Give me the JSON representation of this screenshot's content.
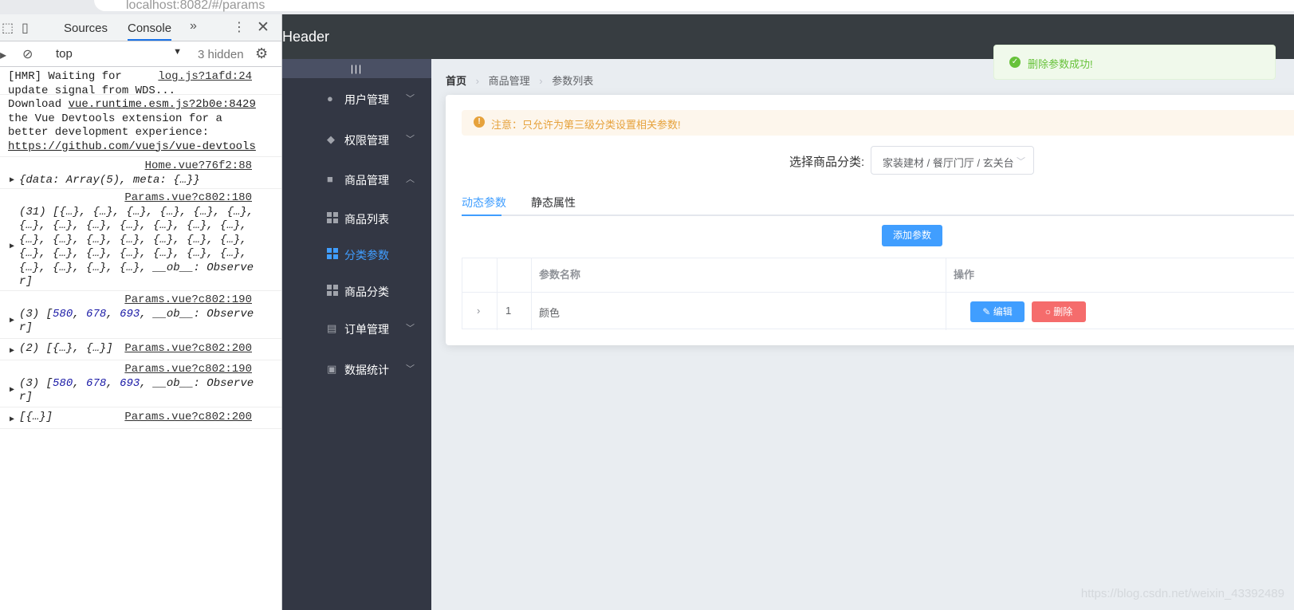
{
  "browser": {
    "url_fragment": "localhost:8082/#/params"
  },
  "devtools": {
    "tabs": [
      "Sources",
      "Console"
    ],
    "active_tab": "Console",
    "context": "top",
    "hidden_count": "3 hidden",
    "logs": [
      {
        "text": "[HMR] Waiting for\nupdate signal from WDS...",
        "source": "log.js?1afd:24"
      },
      {
        "text": "Download ",
        "link": "vue.runtime.esm.js?2b0e:8429",
        "rest": "\nthe Vue Devtools extension for a\nbetter development experience:",
        "url": "https://github.com/vuejs/vue-devtools"
      },
      {
        "source": "Home.vue?76f2:88",
        "object": "{data: Array(5), meta: {…}}"
      },
      {
        "source": "Params.vue?c802:180",
        "object": "(31) [{…}, {…}, {…}, {…}, {…}, {…},\n{…}, {…}, {…}, {…}, {…}, {…}, {…},\n{…}, {…}, {…}, {…}, {…}, {…}, {…},\n{…}, {…}, {…}, {…}, {…}, {…}, {…},\n{…}, {…}, {…}, {…}, __ob__: Observe\nr]"
      },
      {
        "source": "Params.vue?c802:190",
        "object_prefix": "(3) [",
        "values": [
          "580",
          "678",
          "693"
        ],
        "object_suffix": ", __ob__: Observe\nr]"
      },
      {
        "source": "Params.vue?c802:200",
        "object": "(2) [{…}, {…}]"
      },
      {
        "source": "Params.vue?c802:190",
        "object_prefix": "(3) [",
        "values": [
          "580",
          "678",
          "693"
        ],
        "object_suffix": ", __ob__: Observe\nr]"
      },
      {
        "source": "Params.vue?c802:200",
        "object": "[{…}]"
      }
    ]
  },
  "app": {
    "header_title": "Header",
    "toggle_label": "|||",
    "menu": [
      {
        "label": "用户管理",
        "icon": "user-icon"
      },
      {
        "label": "权限管理",
        "icon": "box-icon"
      },
      {
        "label": "商品管理",
        "icon": "bag-icon",
        "expanded": true
      },
      {
        "label": "订单管理",
        "icon": "clipboard-icon"
      },
      {
        "label": "数据统计",
        "icon": "chart-icon"
      }
    ],
    "submenu": [
      {
        "label": "商品列表",
        "active": false
      },
      {
        "label": "分类参数",
        "active": true
      },
      {
        "label": "商品分类",
        "active": false
      }
    ],
    "breadcrumb": [
      "首页",
      "商品管理",
      "参数列表"
    ],
    "alert": "注意：只允许为第三级分类设置相关参数!",
    "category_label": "选择商品分类:",
    "category_value": "家装建材 / 餐厅门厅 / 玄关台",
    "tabs": [
      "动态参数",
      "静态属性"
    ],
    "add_button": "添加参数",
    "table": {
      "headers": [
        "",
        "",
        "参数名称",
        "操作"
      ],
      "rows": [
        {
          "index": "1",
          "name": "颜色"
        }
      ],
      "edit_label": "编辑",
      "delete_label": "删除"
    },
    "toast": "删除参数成功!",
    "watermark": "https://blog.csdn.net/weixin_43392489"
  }
}
